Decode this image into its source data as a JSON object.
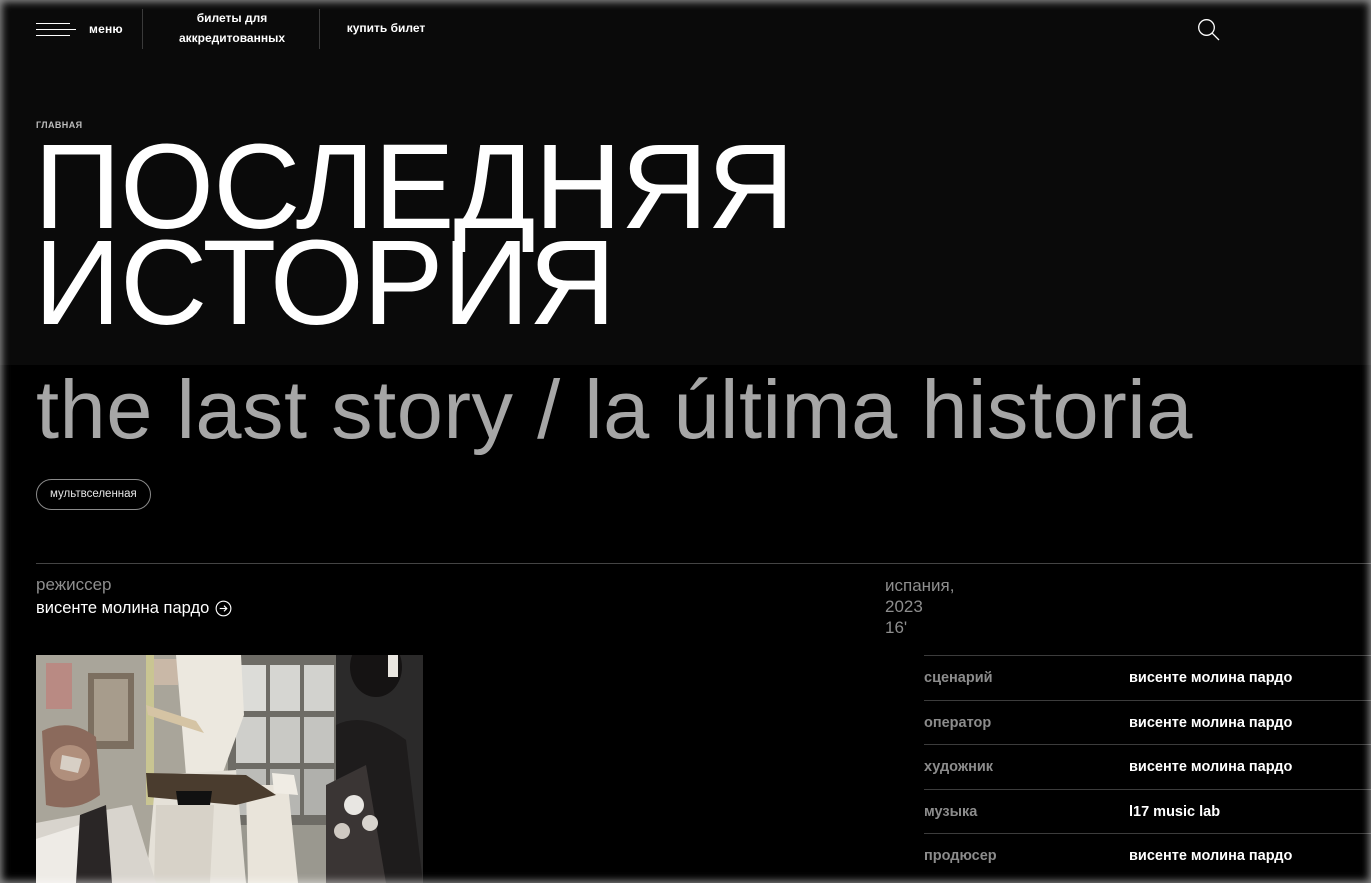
{
  "topbar": {
    "menu_label": "меню",
    "nav_links": [
      {
        "label_line1": "билеты для",
        "label_line2": "аккредитованных"
      },
      {
        "label_line1": "купить билет"
      }
    ],
    "search_icon": "search-icon"
  },
  "breadcrumb": "ГЛАВНАЯ",
  "film": {
    "title_line1": "ПОСЛЕДНЯЯ",
    "title_line2": "ИСТОРИЯ",
    "original_title": "the last story / la última historia",
    "tag": "мультвселенная",
    "director_label": "режиссер",
    "director_name": "висенте молина пардо",
    "country": "испания,",
    "year": "2023",
    "duration": "16'"
  },
  "credits": [
    {
      "role": "сценарий",
      "name": "висенте молина пардо"
    },
    {
      "role": "оператор",
      "name": "висенте молина пардо"
    },
    {
      "role": "художник",
      "name": "висенте молина пардо"
    },
    {
      "role": "музыка",
      "name": "l17 music lab"
    },
    {
      "role": "продюсер",
      "name": "висенте молина пардо"
    }
  ],
  "colors": {
    "background": "#000000",
    "hero_background": "#0a0a0a",
    "subtitle": "#a6a6a6",
    "muted_text": "#8e8e8e",
    "divider": "#3c3c3c"
  }
}
